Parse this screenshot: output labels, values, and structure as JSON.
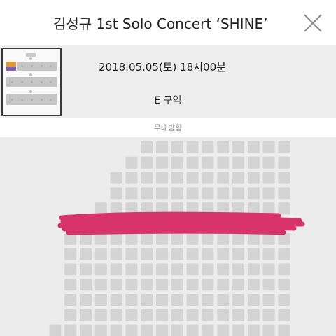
{
  "header": {
    "title": "김성규 1st Solo Concert ‘SHINE’",
    "close_icon": "close-icon"
  },
  "info": {
    "datetime": "2018.05.05(토) 18시00분",
    "zone": "E 구역",
    "stage_direction": "무대방향"
  },
  "minimap": {
    "icon": "venue-minimap",
    "highlight_colors": [
      "#e09a3c",
      "#7b5fc4"
    ]
  },
  "seatmap": {
    "seat_color": "#d4d4d4",
    "background": "#ececec",
    "redaction_color": "#d8336a"
  }
}
